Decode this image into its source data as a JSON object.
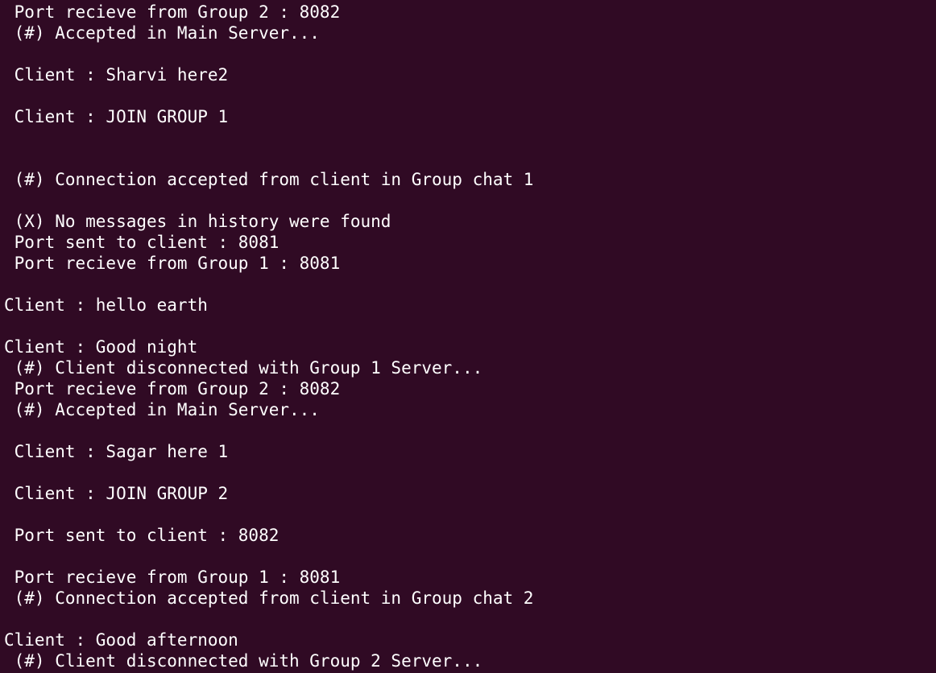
{
  "terminal": {
    "background": "#300a24",
    "foreground": "#ffffff",
    "lines": [
      " Port recieve from Group 2 : 8082",
      " (#) Accepted in Main Server...",
      "",
      " Client : Sharvi here2",
      "",
      " Client : JOIN GROUP 1",
      "",
      "",
      " (#) Connection accepted from client in Group chat 1",
      "",
      " (X) No messages in history were found",
      " Port sent to client : 8081",
      " Port recieve from Group 1 : 8081",
      "",
      "Client : hello earth",
      "",
      "Client : Good night",
      " (#) Client disconnected with Group 1 Server...",
      " Port recieve from Group 2 : 8082",
      " (#) Accepted in Main Server...",
      "",
      " Client : Sagar here 1",
      "",
      " Client : JOIN GROUP 2",
      "",
      " Port sent to client : 8082",
      "",
      " Port recieve from Group 1 : 8081",
      " (#) Connection accepted from client in Group chat 2",
      "",
      "Client : Good afternoon",
      " (#) Client disconnected with Group 2 Server..."
    ]
  }
}
